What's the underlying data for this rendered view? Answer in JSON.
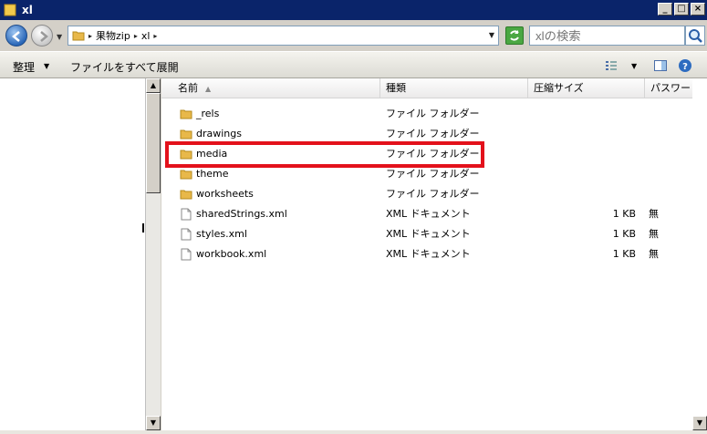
{
  "window": {
    "title": "xl"
  },
  "address": {
    "crumbs": [
      "果物zip",
      "xl"
    ]
  },
  "search": {
    "placeholder": "xlの検索"
  },
  "toolbar": {
    "organize_label": "整理",
    "expand_all_label": "ファイルをすべて展開"
  },
  "columns": {
    "name": "名前",
    "type": "種類",
    "compressed_size": "圧縮サイズ",
    "password": "パスワード保..."
  },
  "files": [
    {
      "name": "_rels",
      "type": "ファイル フォルダー",
      "size": "",
      "password": "",
      "kind": "folder"
    },
    {
      "name": "drawings",
      "type": "ファイル フォルダー",
      "size": "",
      "password": "",
      "kind": "folder"
    },
    {
      "name": "media",
      "type": "ファイル フォルダー",
      "size": "",
      "password": "",
      "kind": "folder"
    },
    {
      "name": "theme",
      "type": "ファイル フォルダー",
      "size": "",
      "password": "",
      "kind": "folder"
    },
    {
      "name": "worksheets",
      "type": "ファイル フォルダー",
      "size": "",
      "password": "",
      "kind": "folder"
    },
    {
      "name": "sharedStrings.xml",
      "type": "XML ドキュメント",
      "size": "1 KB",
      "password": "無",
      "kind": "file"
    },
    {
      "name": "styles.xml",
      "type": "XML ドキュメント",
      "size": "1 KB",
      "password": "無",
      "kind": "file"
    },
    {
      "name": "workbook.xml",
      "type": "XML ドキュメント",
      "size": "1 KB",
      "password": "無",
      "kind": "file"
    }
  ],
  "highlight_row": "media",
  "colors": {
    "titlebar": "#0a246a",
    "highlight_border": "#e3111b",
    "folder": "#e8b84a"
  }
}
